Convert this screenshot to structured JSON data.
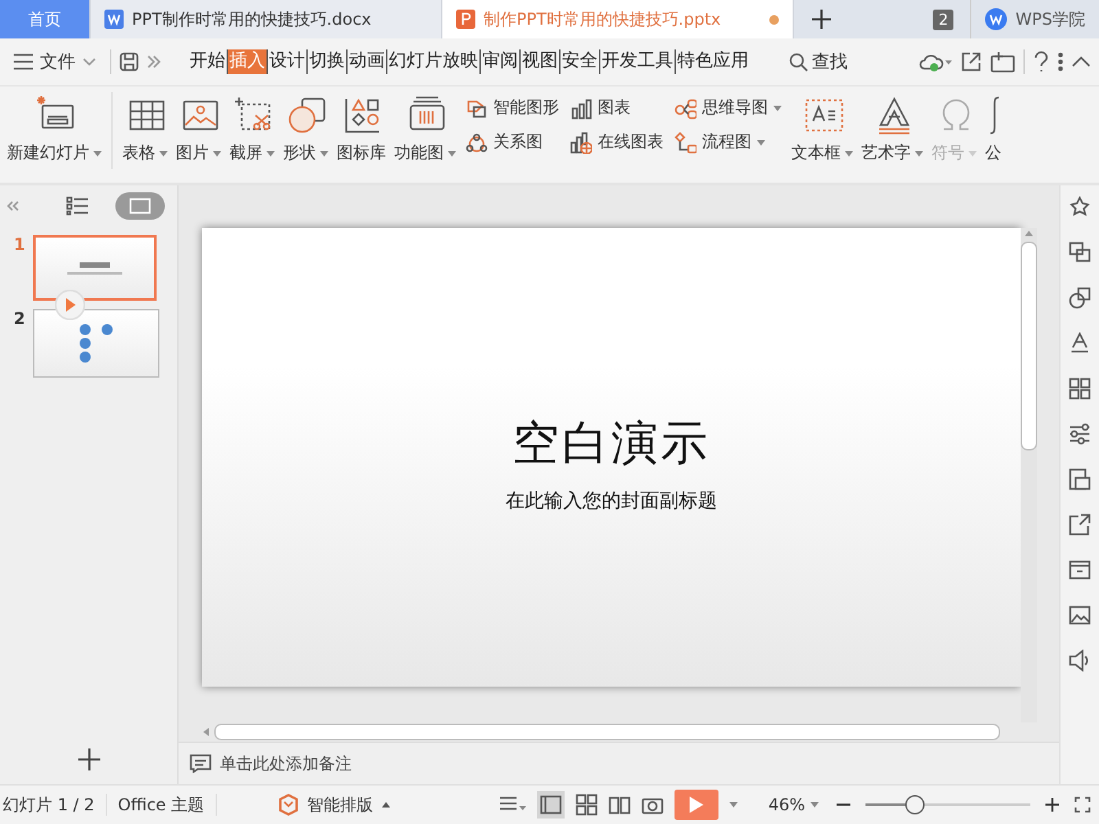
{
  "tabs": [
    {
      "label": "首页",
      "kind": "home",
      "selected": false,
      "modified": false
    },
    {
      "label": "PPT制作时常用的快捷技巧.docx",
      "kind": "writer",
      "selected": false,
      "modified": false
    },
    {
      "label": "制作PPT时常用的快捷技巧.pptx",
      "kind": "presentation",
      "selected": true,
      "modified": true
    }
  ],
  "window_count": "2",
  "account": "WPS学院",
  "menu": {
    "file": "文件",
    "items": [
      {
        "label": "开始",
        "selected": false
      },
      {
        "label": "插入",
        "selected": true
      },
      {
        "label": "设计",
        "selected": false
      },
      {
        "label": "切换",
        "selected": false
      },
      {
        "label": "动画",
        "selected": false
      },
      {
        "label": "幻灯片放映",
        "selected": false
      },
      {
        "label": "审阅",
        "selected": false
      },
      {
        "label": "视图",
        "selected": false
      },
      {
        "label": "安全",
        "selected": false
      },
      {
        "label": "开发工具",
        "selected": false
      },
      {
        "label": "特色应用",
        "selected": false
      }
    ],
    "search": "查找"
  },
  "ribbon": [
    {
      "kind": "large",
      "label": "新建幻灯片",
      "dropdown": true,
      "disabled": false
    },
    {
      "kind": "large",
      "label": "表格",
      "dropdown": true,
      "disabled": false
    },
    {
      "kind": "large",
      "label": "图片",
      "dropdown": true,
      "disabled": false
    },
    {
      "kind": "large",
      "label": "截屏",
      "dropdown": true,
      "disabled": false
    },
    {
      "kind": "large",
      "label": "形状",
      "dropdown": true,
      "disabled": false
    },
    {
      "kind": "large",
      "label": "图标库",
      "dropdown": false,
      "disabled": false
    },
    {
      "kind": "large",
      "label": "功能图",
      "dropdown": true,
      "disabled": false
    },
    {
      "kind": "stack",
      "items": [
        {
          "label": "智能图形",
          "dropdown": false
        },
        {
          "label": "关系图",
          "dropdown": false
        }
      ]
    },
    {
      "kind": "stack",
      "items": [
        {
          "label": "图表",
          "dropdown": false
        },
        {
          "label": "在线图表",
          "dropdown": false
        }
      ]
    },
    {
      "kind": "stack",
      "items": [
        {
          "label": "思维导图",
          "dropdown": true
        },
        {
          "label": "流程图",
          "dropdown": true
        }
      ]
    },
    {
      "kind": "large",
      "label": "文本框",
      "dropdown": true,
      "disabled": false
    },
    {
      "kind": "large",
      "label": "艺术字",
      "dropdown": true,
      "disabled": false
    },
    {
      "kind": "large",
      "label": "符号",
      "dropdown": true,
      "disabled": true
    },
    {
      "kind": "large",
      "label": "公",
      "dropdown": false,
      "disabled": false
    }
  ],
  "panel_views": [
    {
      "kind": "outline",
      "selected": false
    },
    {
      "kind": "thumbnails",
      "selected": true
    }
  ],
  "slides": [
    {
      "number": "1",
      "kind": "title",
      "selected": true
    },
    {
      "number": "2",
      "kind": "dots",
      "selected": false
    }
  ],
  "slide": {
    "title": "空白演示",
    "subtitle": "在此输入您的封面副标题"
  },
  "notes": {
    "placeholder": "单击此处添加备注"
  },
  "status_bar": {
    "slide_counter": "幻灯片 1 / 2",
    "theme": "Office 主题",
    "smart_layout": "智能排版",
    "zoom": "46%",
    "level": 0.3
  }
}
